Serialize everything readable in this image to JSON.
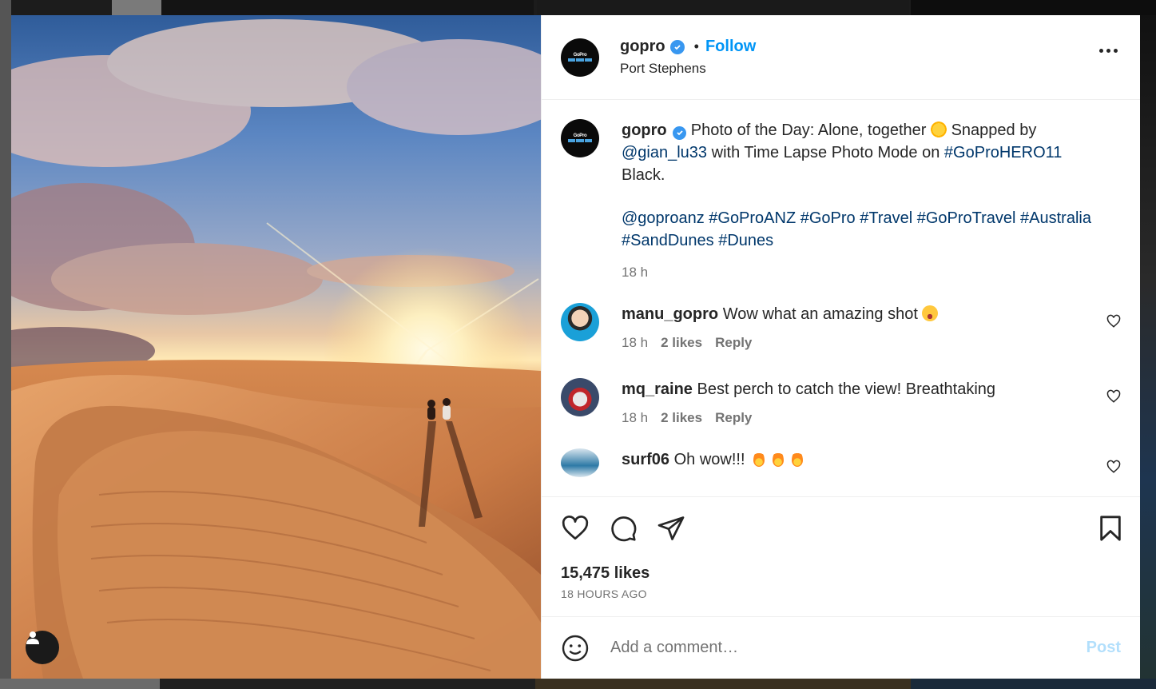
{
  "post": {
    "username": "gopro",
    "follow_label": "Follow",
    "separator": "•",
    "location": "Port Stephens",
    "logo_text": "GoPro"
  },
  "caption": {
    "username": "gopro",
    "text_1": "Photo of the Day: Alone, together",
    "text_2": "Snapped by",
    "mention": "@gian_lu33",
    "text_3": "with Time Lapse Photo Mode on",
    "hashtag_main": "#GoProHERO11",
    "text_4": "Black.",
    "tags_line_1": "@goproanz #GoProANZ #GoPro #Travel #GoProTravel #Australia",
    "tags_line_2": "#SandDunes #Dunes",
    "time": "18 h"
  },
  "comments": [
    {
      "username": "manu_gopro",
      "text": "Wow what an amazing shot",
      "time": "18 h",
      "likes": "2 likes",
      "reply": "Reply",
      "emoji": "star-struck-emoji"
    },
    {
      "username": "mq_raine",
      "text": "Best perch to catch the view! Breathtaking",
      "time": "18 h",
      "likes": "2 likes",
      "reply": "Reply"
    },
    {
      "username": "surf06",
      "text": "Oh wow!!!",
      "emoji": "fire-emoji"
    }
  ],
  "footer": {
    "likes": "15,475 likes",
    "posted": "18 HOURS AGO",
    "comment_placeholder": "Add a comment…",
    "post_label": "Post"
  },
  "colors": {
    "accent": "#0095f6",
    "link": "#00376b",
    "muted": "#737373",
    "post_disabled": "#b2dffc"
  }
}
